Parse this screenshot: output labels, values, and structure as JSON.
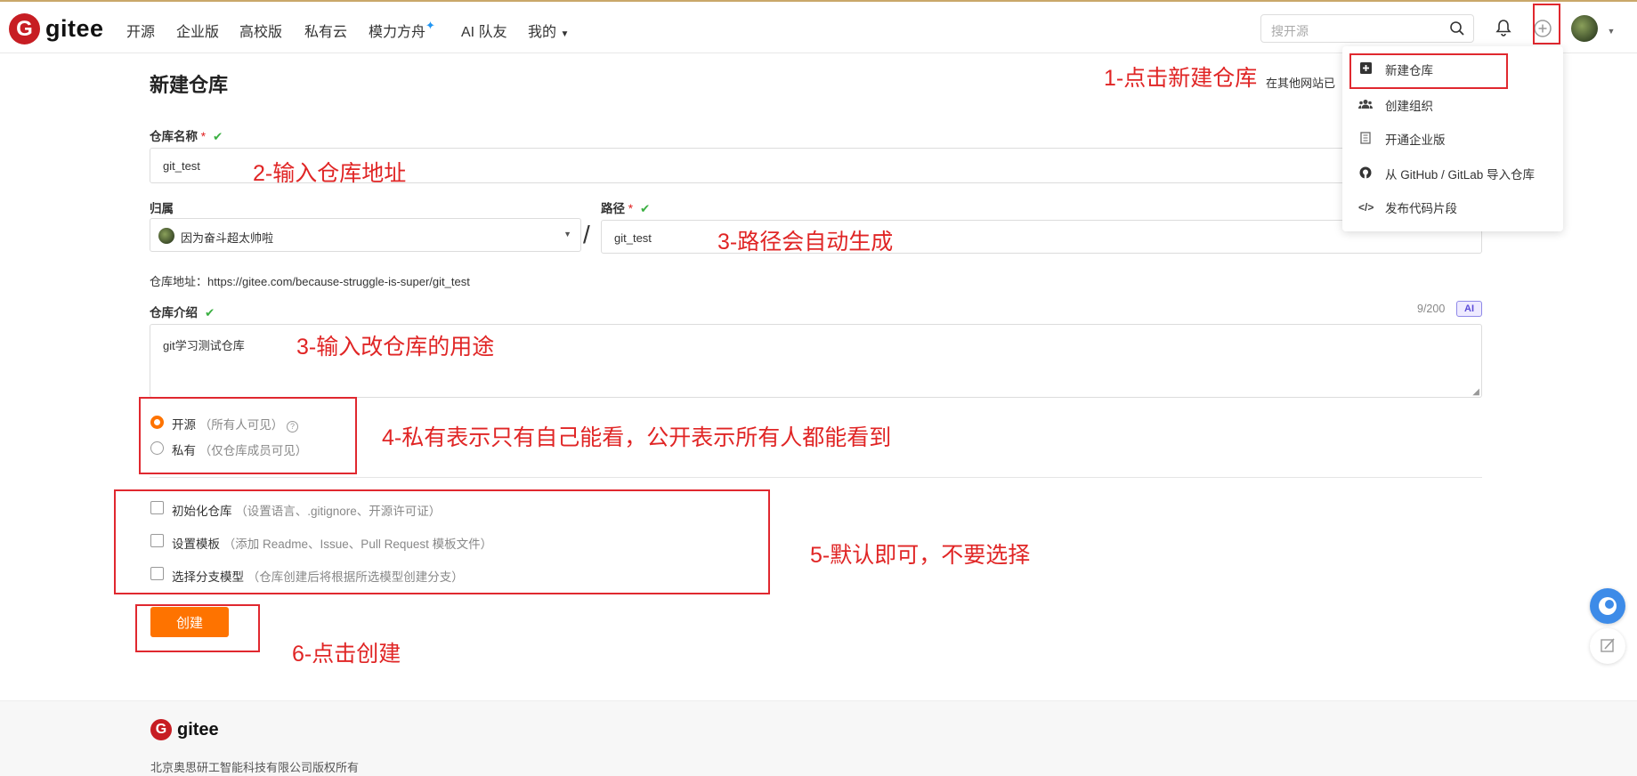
{
  "brand": {
    "name": "gitee",
    "logo_letter": "G",
    "color": "#c71d23"
  },
  "nav": {
    "items": [
      "开源",
      "企业版",
      "高校版",
      "私有云",
      "模力方舟",
      "AI 队友",
      "我的"
    ],
    "search_placeholder": "搜开源"
  },
  "dropdown": {
    "items": [
      {
        "label": "新建仓库",
        "icon": "plus-square-icon"
      },
      {
        "label": "创建组织",
        "icon": "users-icon"
      },
      {
        "label": "开通企业版",
        "icon": "building-icon"
      },
      {
        "label": "从 GitHub / GitLab 导入仓库",
        "icon": "github-icon"
      },
      {
        "label": "发布代码片段",
        "icon": "code-icon"
      }
    ]
  },
  "form": {
    "title": "新建仓库",
    "import_hint": "在其他网站已",
    "repo_name_label": "仓库名称",
    "repo_name_value": "git_test",
    "owner_label": "归属",
    "owner_value": "因为奋斗超太帅啦",
    "path_label": "路径",
    "path_value": "git_test",
    "path_separator": "/",
    "repo_url_label": "仓库地址：",
    "repo_url_value": "https://gitee.com/because-struggle-is-super/git_test",
    "desc_label": "仓库介绍",
    "desc_count": "9/200",
    "ai_badge": "AI",
    "desc_value": "git学习测试仓库",
    "visibility": {
      "public_label": "开源",
      "public_hint": "（所有人可见）",
      "private_label": "私有",
      "private_hint": "（仅仓库成员可见）",
      "selected": "public"
    },
    "options": [
      {
        "label": "初始化仓库",
        "hint": "（设置语言、.gitignore、开源许可证）"
      },
      {
        "label": "设置模板",
        "hint": "（添加 Readme、Issue、Pull Request 模板文件）"
      },
      {
        "label": "选择分支模型",
        "hint": "（仓库创建后将根据所选模型创建分支）"
      }
    ],
    "create_button": "创建"
  },
  "annotations": {
    "a1": "1-点击新建仓库",
    "a2": "2-输入仓库地址",
    "a3": "3-路径会自动生成",
    "a3b": "3-输入改仓库的用途",
    "a4": "4-私有表示只有自己能看，公开表示所有人都能看到",
    "a5": "5-默认即可，不要选择",
    "a6": "6-点击创建"
  },
  "footer": {
    "brand": "gitee",
    "copyright": "北京奥思研工智能科技有限公司版权所有"
  },
  "colors": {
    "accent": "#fe7300",
    "annotation": "#e02525",
    "success": "#3cb043"
  }
}
